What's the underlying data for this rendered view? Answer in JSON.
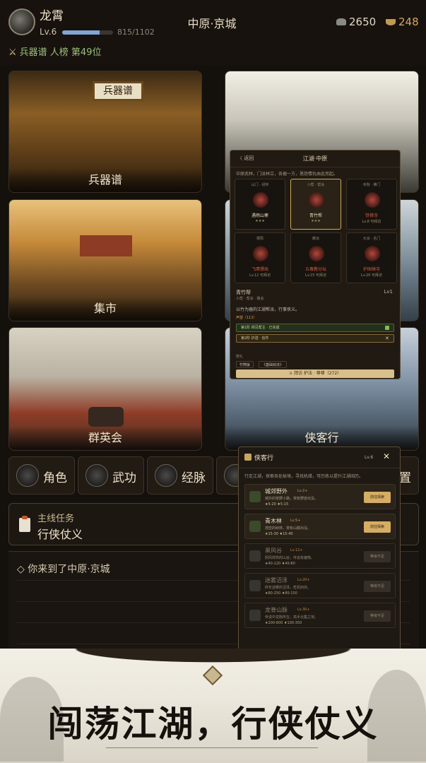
{
  "player": {
    "name": "龙霄",
    "level": "Lv.6",
    "exp_text": "815/1102",
    "exp_fraction": 0.74
  },
  "location": "中原·京城",
  "currency": {
    "silver": "2650",
    "gold": "248",
    "silver_icon": "silver-ingot-icon",
    "gold_icon": "gold-ingot-icon"
  },
  "rank": {
    "icon": "crossed-swords-icon",
    "text": "兵器谱 人榜 第49位"
  },
  "scenes": {
    "armory": "兵器谱",
    "armory_sign": "兵器谱",
    "market": "集市",
    "heroes": "群英会",
    "xiake": "侠客行"
  },
  "functions": [
    {
      "label": "角色",
      "icon": "character-portrait-icon"
    },
    {
      "label": "武功",
      "icon": "martial-arts-icon"
    },
    {
      "label": "经脉",
      "icon": "meridian-icon"
    },
    {
      "label": "置",
      "icon": "settings-icon"
    }
  ],
  "quest": {
    "label": "主线任务",
    "title": "行侠仗义",
    "icon": "scroll-icon"
  },
  "log": [
    "◇ 你来到了中原·京城"
  ],
  "jianghu": {
    "back": "〈 返回",
    "title": "江湖·中原",
    "desc": "中原武林，门派林立，各据一方，恩怨情仇由此而起。",
    "sects": [
      {
        "tag": "山门 · 绿林",
        "name": "遇雨山寨",
        "sub": "★★★",
        "red": false
      },
      {
        "tag": "小帮 · 帮会",
        "name": "青竹帮",
        "sub": "★★★",
        "red": false
      },
      {
        "tag": "寺院 · 佛门",
        "name": "铁佛寺",
        "sub": "Lv.8 可拜访",
        "red": true
      },
      {
        "tag": "镖局",
        "name": "飞鹰镖局",
        "sub": "Lv.12 可拜访",
        "red": true
      },
      {
        "tag": "教派",
        "name": "五毒教分坛",
        "sub": "Lv.15 可拜访",
        "red": true
      },
      {
        "tag": "大派 · 名门",
        "name": "护国禅寺",
        "sub": "Lv.20 可拜访",
        "red": true
      }
    ],
    "selected_name": "青竹帮",
    "selected_lv": "Lv1",
    "selected_tags": "小帮 · 帮会 · 路会",
    "intro": "以竹为器的江湖帮派，行事侠义。",
    "rep": "声望（112）",
    "quests": [
      "第1阶 拜见帮主 · 已完成",
      "第2阶 护送 · 信件"
    ],
    "gift_label": "赠礼",
    "gifts": [
      "竹筒饭",
      "《基础剑法》"
    ],
    "action": "⚔ 拜访 护法 · 尊尊（272）"
  },
  "xiake": {
    "title": "侠客行",
    "level": "Lv.6",
    "desc": "行走江湖，探索各处秘境，寻找机缘，可历练以提升江湖阅历。",
    "areas": [
      {
        "name": "城郊野外",
        "lv": "Lv.2+",
        "desc": "城外的荒野小路，常有野兽出没。",
        "reward": "★5-20  ♦5-15",
        "btn": "前往探索",
        "locked": false
      },
      {
        "name": "青木林",
        "lv": "Lv.5+",
        "desc": "茂密的树林，常有山贼出没。",
        "reward": "★15-30  ♦15-40",
        "btn": "前往探索",
        "locked": false
      },
      {
        "name": "黑风谷",
        "lv": "Lv.12+",
        "desc": "阴风阵阵的山谷，传说有魔物。",
        "reward": "★40-120  ♦40-80",
        "btn": "等级不足",
        "locked": true
      },
      {
        "name": "迷雾沼泽",
        "lv": "Lv.20+",
        "desc": "终年迷雾的沼泽，危机四伏。",
        "reward": "★80-250  ♦80-150",
        "btn": "等级不足",
        "locked": true
      },
      {
        "name": "龙脊山脉",
        "lv": "Lv.30+",
        "desc": "传说中龙脉所在，高手云集之地。",
        "reward": "★200-600  ♦100-350",
        "btn": "等级不足",
        "locked": true
      }
    ]
  },
  "banner": {
    "slogan": "闯荡江湖，行侠仗义"
  }
}
